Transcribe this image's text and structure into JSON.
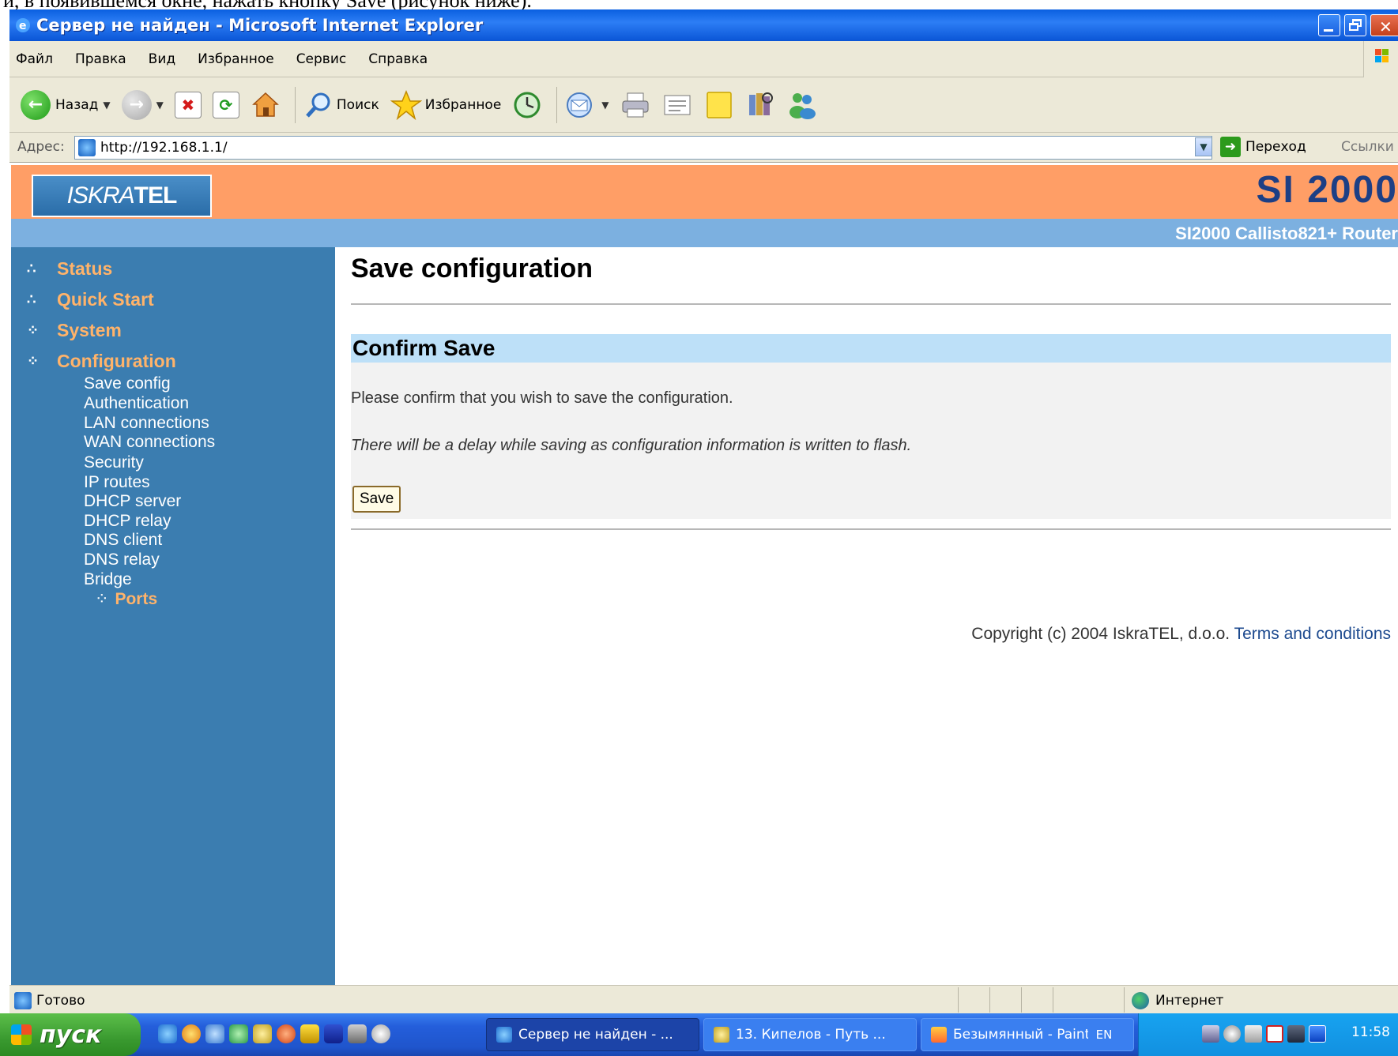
{
  "doc_line": "и, в появившемся окне, нажать кнопку Save (рисунок ниже).",
  "window": {
    "title": "Сервер не найден - Microsoft Internet Explorer"
  },
  "menu": [
    "Файл",
    "Правка",
    "Вид",
    "Избранное",
    "Сервис",
    "Справка"
  ],
  "toolbar": {
    "back": "Назад",
    "search": "Поиск",
    "favorites": "Избранное"
  },
  "address": {
    "label": "Адрес:",
    "url": "http://192.168.1.1/",
    "go": "Переход",
    "links": "Ссылки"
  },
  "banner": {
    "logo_light": "ISKRA",
    "logo_bold": "TEL",
    "brand": "SI 2000",
    "router": "SI2000 Callisto821+ Router"
  },
  "sidebar": {
    "top": [
      {
        "label": "Status"
      },
      {
        "label": "Quick Start"
      },
      {
        "label": "System"
      },
      {
        "label": "Configuration"
      }
    ],
    "sub": [
      "Save config",
      "Authentication",
      "LAN connections",
      "WAN connections",
      "Security",
      "IP routes",
      "DHCP server",
      "DHCP relay",
      "DNS client",
      "DNS relay",
      "Bridge"
    ],
    "active": "Ports"
  },
  "content": {
    "title": "Save configuration",
    "section": "Confirm Save",
    "confirm": "Please confirm that you wish to save the configuration.",
    "delay": "There will be a delay while saving as configuration information is written to flash.",
    "save_button": "Save",
    "copyright": "Copyright (c) 2004 IskraTEL, d.o.o.",
    "terms": "Terms and conditions"
  },
  "status": {
    "text": "Готово",
    "zone": "Интернет"
  },
  "taskbar": {
    "start": "пуск",
    "tasks": [
      "Сервер не найден - ...",
      "13. Кипелов - Путь ...",
      "Безымянный - Paint"
    ],
    "lang": "EN",
    "clock": "11:58"
  },
  "colors": {
    "banner": "#ff9e66",
    "sidebar": "#3b7db0",
    "nav_accent": "#ffb36a",
    "section_head": "#bde0f8"
  }
}
